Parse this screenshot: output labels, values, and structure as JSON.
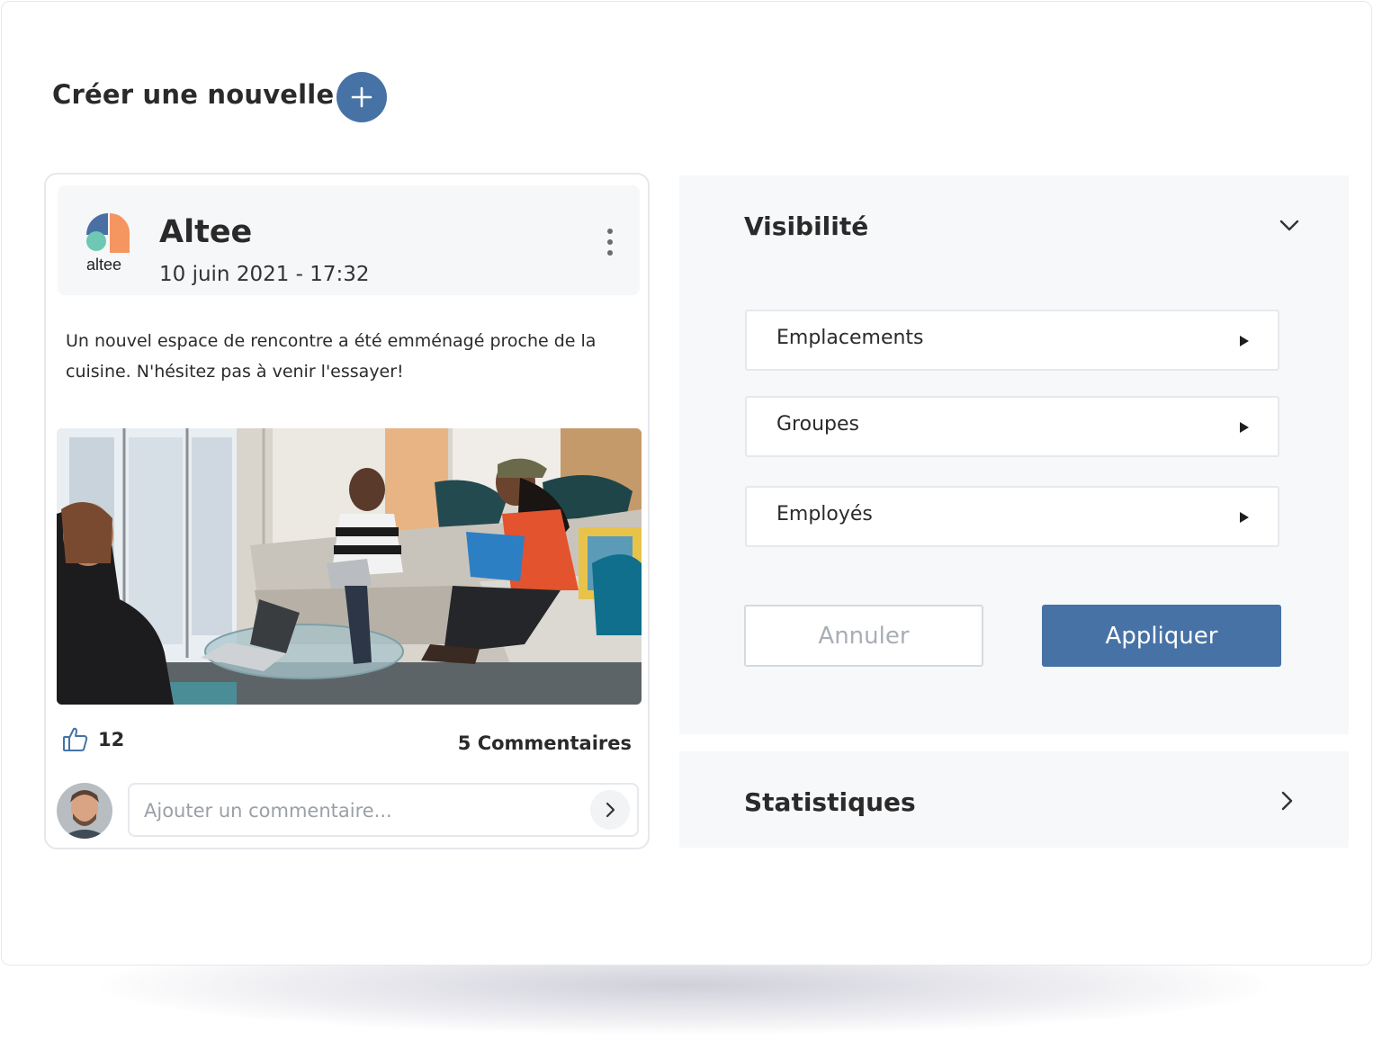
{
  "page": {
    "create_title": "Créer une nouvelle",
    "create_button_icon": "plus-icon"
  },
  "post": {
    "logo_text": "altee",
    "author": "Altee",
    "date": "10 juin 2021 - 17:32",
    "menu_icon": "more-vertical-icon",
    "text": "Un nouvel espace de rencontre a été emménagé proche de la cuisine. N'hésitez pas à venir l'essayer!",
    "likes": "12",
    "comments_label": "5 Commentaires",
    "comment_placeholder": "Ajouter un commentaire..."
  },
  "visibility": {
    "title": "Visibilité",
    "options": [
      {
        "label": "Emplacements"
      },
      {
        "label": "Groupes"
      },
      {
        "label": "Employés"
      }
    ],
    "cancel_label": "Annuler",
    "apply_label": "Appliquer"
  },
  "statistics": {
    "title": "Statistiques"
  },
  "colors": {
    "accent": "#4672a6",
    "panel_bg": "#f7f8fa",
    "border": "#e6e8ec"
  }
}
